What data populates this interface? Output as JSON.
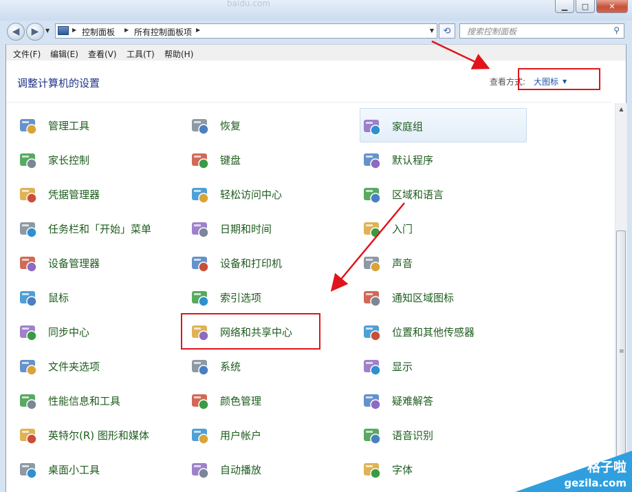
{
  "window": {
    "faint_title": "baidu.com"
  },
  "nav": {
    "crumbs": [
      "控制面板",
      "所有控制面板项"
    ],
    "search_placeholder": "搜索控制面板"
  },
  "menu": [
    "文件(F)",
    "编辑(E)",
    "查看(V)",
    "工具(T)",
    "帮助(H)"
  ],
  "header": {
    "heading": "调整计算机的设置",
    "view_label": "查看方式:",
    "view_value": "大图标"
  },
  "items": [
    [
      "管理工具",
      "家长控制",
      "凭据管理器",
      "任务栏和「开始」菜单",
      "设备管理器",
      "鼠标",
      "同步中心",
      "文件夹选项",
      "性能信息和工具",
      "英特尔(R) 图形和媒体",
      "桌面小工具"
    ],
    [
      "恢复",
      "键盘",
      "轻松访问中心",
      "日期和时间",
      "设备和打印机",
      "索引选项",
      "网络和共享中心",
      "系统",
      "颜色管理",
      "用户帐户",
      "自动播放"
    ],
    [
      "家庭组",
      "默认程序",
      "区域和语言",
      "入门",
      "声音",
      "通知区域图标",
      "位置和其他传感器",
      "显示",
      "疑难解答",
      "语音识别",
      "字体"
    ]
  ],
  "icons": [
    [
      "tools-gear-icon",
      "parental-control-icon",
      "credential-vault-icon",
      "taskbar-icon",
      "device-manager-icon",
      "mouse-icon",
      "sync-center-icon",
      "folder-options-icon",
      "performance-icon",
      "intel-graphics-icon",
      "desktop-gadgets-icon"
    ],
    [
      "recovery-icon",
      "keyboard-icon",
      "ease-of-access-icon",
      "calendar-clock-icon",
      "devices-printers-icon",
      "indexing-search-icon",
      "network-sharing-icon",
      "system-monitor-icon",
      "color-management-icon",
      "user-accounts-icon",
      "autoplay-icon"
    ],
    [
      "homegroup-icon",
      "default-programs-icon",
      "globe-clock-icon",
      "getting-started-icon",
      "speaker-icon",
      "notification-area-icon",
      "location-sensors-icon",
      "display-icon",
      "troubleshooting-icon",
      "microphone-icon",
      "fonts-folder-icon"
    ]
  ],
  "watermark": {
    "line1": "格子啦",
    "line2": "gezila.com"
  },
  "colors": {
    "link_green": "#1e5c1e",
    "heading_blue": "#1e3287",
    "annotation_red": "#e0141a"
  }
}
